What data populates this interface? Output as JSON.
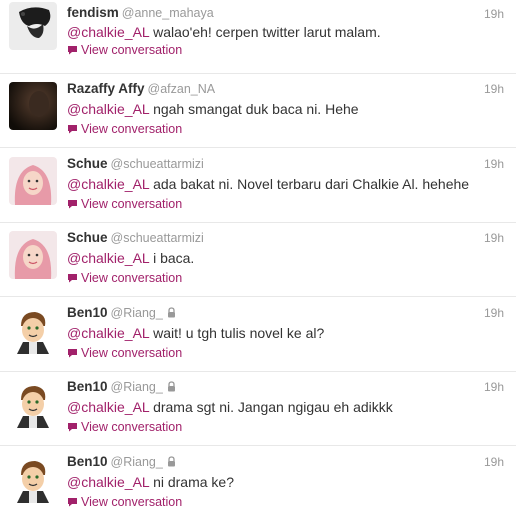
{
  "colors": {
    "accent": "#a1216a",
    "muted": "#999999",
    "text": "#333333",
    "divider": "#e8e8e8"
  },
  "tweets": [
    {
      "name": "fendism",
      "handle": "@anne_mahaya",
      "mention": "@chalkie_AL",
      "text": " walao'eh! cerpen twitter larut malam.",
      "action": "View conversation",
      "time": "19h",
      "avatar": "dark-hair-avatar",
      "locked": false
    },
    {
      "name": "Razaffy Affy",
      "handle": "@afzan_NA",
      "mention": "@chalkie_AL",
      "text": " ngah smangat duk baca ni. Hehe",
      "action": "View conversation",
      "time": "19h",
      "avatar": "dark-photo-avatar",
      "locked": false
    },
    {
      "name": "Schue",
      "handle": "@schueattarmizi",
      "mention": "@chalkie_AL",
      "text": " ada bakat ni. Novel terbaru dari Chalkie Al. hehehe",
      "action": "View conversation",
      "time": "19h",
      "avatar": "pink-hijab-avatar",
      "locked": false
    },
    {
      "name": "Schue",
      "handle": "@schueattarmizi",
      "mention": "@chalkie_AL",
      "text": " i baca.",
      "action": "View conversation",
      "time": "19h",
      "avatar": "pink-hijab-avatar",
      "locked": false
    },
    {
      "name": "Ben10",
      "handle": "@Riang_",
      "mention": "@chalkie_AL",
      "text": " wait! u tgh tulis novel ke al?",
      "action": "View conversation",
      "time": "19h",
      "avatar": "cartoon-boy-avatar",
      "locked": true
    },
    {
      "name": "Ben10",
      "handle": "@Riang_",
      "mention": "@chalkie_AL",
      "text": " drama sgt ni. Jangan ngigau eh adikkk",
      "action": "View conversation",
      "time": "19h",
      "avatar": "cartoon-boy-avatar",
      "locked": true
    },
    {
      "name": "Ben10",
      "handle": "@Riang_",
      "mention": "@chalkie_AL",
      "text": " ni drama ke?",
      "action": "View conversation",
      "time": "19h",
      "avatar": "cartoon-boy-avatar",
      "locked": true
    }
  ]
}
